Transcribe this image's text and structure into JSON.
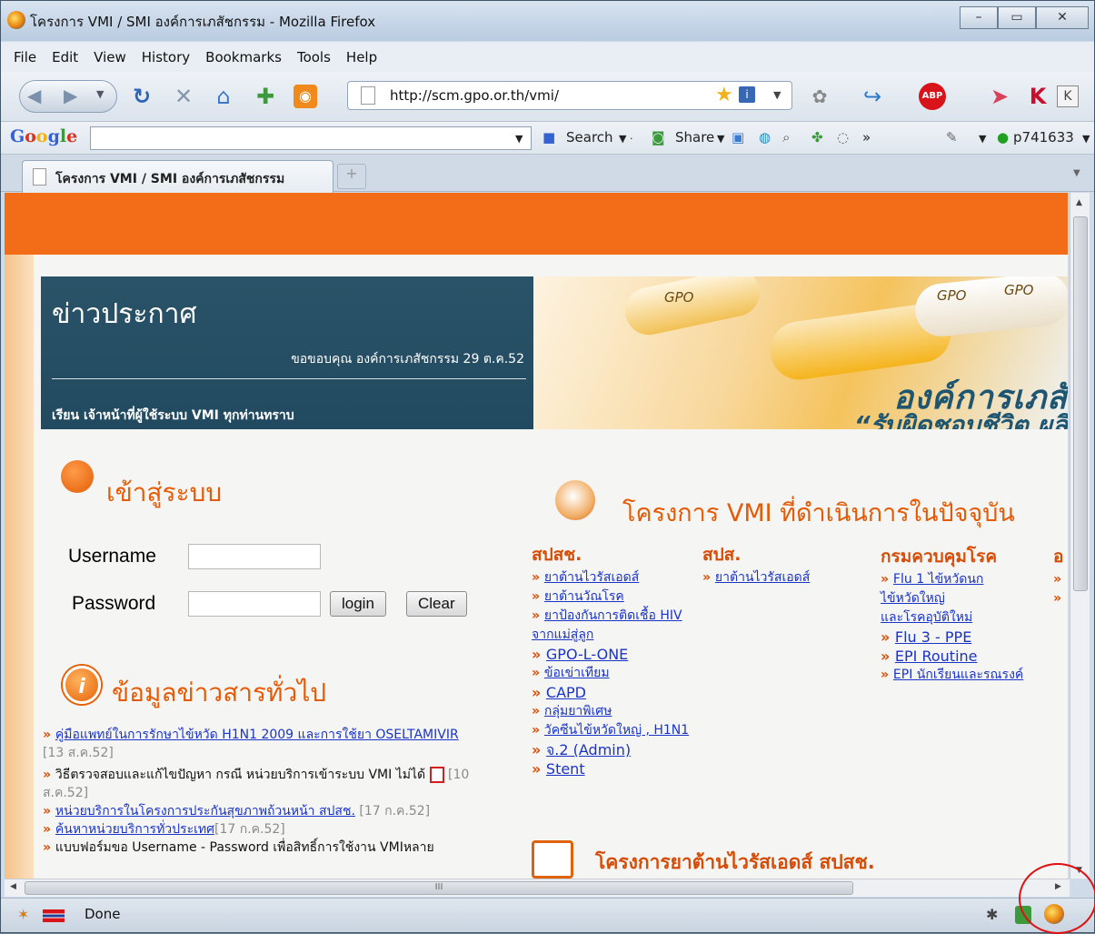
{
  "window": {
    "title": "โครงการ VMI / SMI องค์การเภสัชกรรม - Mozilla Firefox",
    "minimize": "–",
    "maximize": "▭",
    "close": "✕"
  },
  "menu": [
    "File",
    "Edit",
    "View",
    "History",
    "Bookmarks",
    "Tools",
    "Help"
  ],
  "nav": {
    "url": "http://scm.gpo.or.th/vmi/"
  },
  "google_toolbar": {
    "logo": "Google",
    "search_label": "Search",
    "share_label": "Share",
    "more": "»",
    "account": "p741633"
  },
  "tab": {
    "label": "โครงการ VMI / SMI องค์การเภสัชกรรม",
    "new_tab": "+"
  },
  "news": {
    "title": "ข่าวประกาศ",
    "thanks": "ขอขอบคุณ องค์การเภสัชกรรม 29 ต.ค.52",
    "notice": "เรียน เจ้าหน้าที่ผู้ใช้ระบบ VMI ทุกท่านทราบ"
  },
  "banner": {
    "line1": "องค์การเภสั",
    "line2": "“รับผิดชอบชีวิต ผลิ",
    "capsule_text": "GPO"
  },
  "login": {
    "heading": "เข้าสู่ระบบ",
    "username_label": "Username",
    "password_label": "Password",
    "login_button": "login",
    "clear_button": "Clear"
  },
  "info": {
    "heading": "ข้อมูลข่าวสารทั่วไป",
    "items": [
      {
        "link": "คู่มือแพทย์ในการรักษาไข้หวัด H1N1 2009 และการใช้ยา OSELTAMIVIR",
        "date": "[13 ส.ค.52]"
      },
      {
        "text": "วิธีตรวจสอบและแก้ไขปัญหา กรณี หน่วยบริการเข้าระบบ VMI ไม่ได้",
        "date": "[10 ส.ค.52]"
      },
      {
        "link": "หน่วยบริการในโครงการประกันสุขภาพถ้วนหน้า สปสช.",
        "date": "[17 ก.ค.52]"
      },
      {
        "link": "ค้นหาหน่วยบริการทั่วประเทศ",
        "date": "[17 ก.ค.52]"
      },
      {
        "text": "แบบฟอร์มขอ Username - Password เพื่อสิทธิ์การใช้งาน VMIหลาย"
      }
    ]
  },
  "projects": {
    "heading": "โครงการ VMI ที่ดำเนินการในปัจจุบัน",
    "col1": {
      "head": "สปสช.",
      "items": [
        "ยาต้านไวรัสเอดส์",
        "ยาต้านวัณโรค",
        "ยาป้องกันการติดเชื้อ HIV",
        "จากแม่สู่ลูก",
        "GPO-L-ONE",
        "ข้อเข่าเทียม",
        "CAPD",
        "กลุ่มยาพิเศษ",
        "วัคซีนไข้หวัดใหญ่ , H1N1",
        "จ.2 (Admin)",
        "Stent"
      ]
    },
    "col2": {
      "head": "สปส.",
      "items": [
        "ยาต้านไวรัสเอดส์"
      ]
    },
    "col3": {
      "head": "กรมควบคุมโรค",
      "items": [
        "Flu 1 ไข้หวัดนก",
        "ไข้หวัดใหญ่",
        "และโรคอุบัติใหม่",
        "Flu 3 - PPE",
        "EPI Routine",
        "EPI นักเรียนและรณรงค์"
      ]
    },
    "col4_head": "อ"
  },
  "clip": {
    "heading": "โครงการยาต้านไวรัสเอดส์ สปสช."
  },
  "status": {
    "text": "Done",
    "hscroll_grip": "III"
  }
}
